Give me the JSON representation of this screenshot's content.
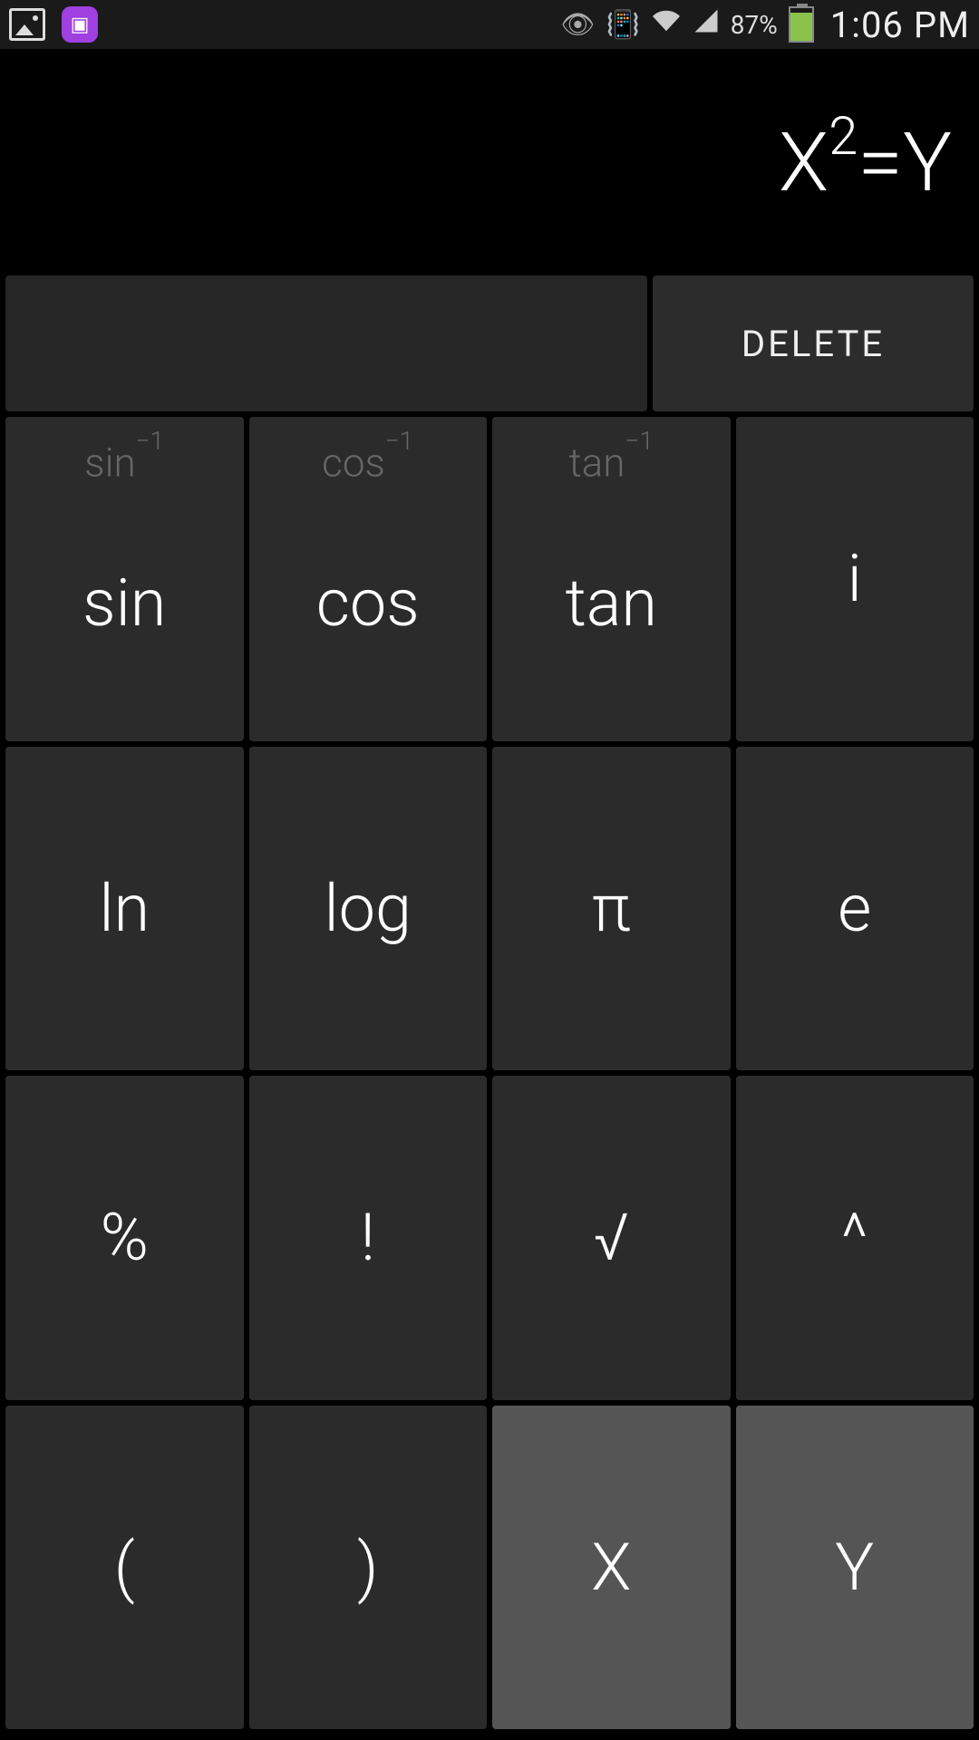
{
  "status": {
    "battery_percent": "87%",
    "time": "1:06 PM"
  },
  "display": {
    "base": "X",
    "exponent": "2",
    "tail": "=Y"
  },
  "top": {
    "delete_label": "DELETE"
  },
  "keys": {
    "r0c0": {
      "alt_base": "sin",
      "alt_sup": "−1",
      "main": "sin"
    },
    "r0c1": {
      "alt_base": "cos",
      "alt_sup": "−1",
      "main": "cos"
    },
    "r0c2": {
      "alt_base": "tan",
      "alt_sup": "−1",
      "main": "tan"
    },
    "r0c3": {
      "main": "i"
    },
    "r1c0": {
      "main": "ln"
    },
    "r1c1": {
      "main": "log"
    },
    "r1c2": {
      "main": "π"
    },
    "r1c3": {
      "main": "e"
    },
    "r2c0": {
      "main": "%"
    },
    "r2c1": {
      "main": "!"
    },
    "r2c2": {
      "main": "√"
    },
    "r2c3": {
      "main": "^"
    },
    "r3c0": {
      "main": "("
    },
    "r3c1": {
      "main": ")"
    },
    "r3c2": {
      "main": "X"
    },
    "r3c3": {
      "main": "Y"
    }
  }
}
